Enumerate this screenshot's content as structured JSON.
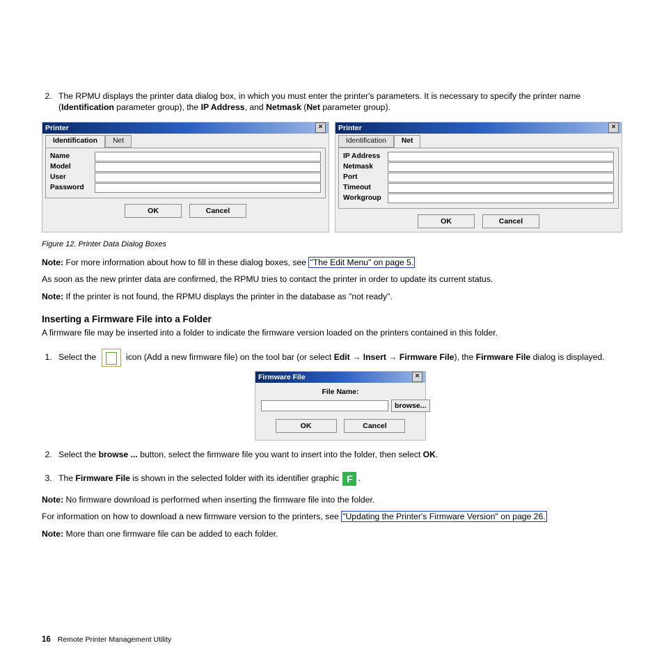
{
  "list2": {
    "pre": "The RPMU displays the printer data dialog box, in which you must enter the printer's parameters. It is necessary to specify the printer name (",
    "b1": "Identification",
    "mid1": " parameter group), the ",
    "b2": "IP Address",
    "mid2": ", and ",
    "b3": "Netmask",
    "mid3": " (",
    "b4": "Net",
    "post": " parameter group)."
  },
  "dlg1": {
    "title": "Printer",
    "tab1": "Identification",
    "tab2": "Net",
    "f1": "Name",
    "f2": "Model",
    "f3": "User",
    "f4": "Password",
    "ok": "OK",
    "cancel": "Cancel"
  },
  "dlg2": {
    "title": "Printer",
    "tab1": "Identification",
    "tab2": "Net",
    "f1": "IP Address",
    "f2": "Netmask",
    "f3": "Port",
    "f4": "Timeout",
    "f5": "Workgroup",
    "ok": "OK",
    "cancel": "Cancel"
  },
  "caption": "Figure 12. Printer Data Dialog Boxes",
  "note1": {
    "b": "Note:",
    "t": " For more information about how to fill in these dialog boxes, see ",
    "link": "\"The Edit Menu\" on page 5."
  },
  "p_after": "As soon as the new printer data are confirmed, the RPMU tries to contact the printer in order to update its current status.",
  "note2": {
    "b": "Note:",
    "t": " If the printer is not found, the RPMU displays the printer in the database as \"not ready\"."
  },
  "section_h": "Inserting a Firmware File into a Folder",
  "section_p": "A firmware file may be inserted into a folder to indicate the firmware version loaded on the printers contained in this folder.",
  "step1": {
    "pre": "Select the ",
    "mid": " icon (Add a new firmware file) on the tool bar (or select ",
    "b1": "Edit",
    "arrow": " → ",
    "b2": "Insert",
    "b3": "Firmware File",
    "close": "), the ",
    "b4": "Firmware File",
    "end": " dialog is displayed."
  },
  "fwdlg": {
    "title": "Firmware File",
    "label": "File Name:",
    "browse": "browse...",
    "ok": "OK",
    "cancel": "Cancel"
  },
  "step2": {
    "pre": "Select the ",
    "b1": "browse ...",
    "mid": " button, select the firmware file you want to insert into the folder, then select ",
    "b2": "OK",
    "end": "."
  },
  "step3": {
    "pre": "The ",
    "b1": "Firmware File",
    "mid": " is shown in the selected folder with its identifier graphic ",
    "icon": "F",
    "end": "."
  },
  "note3": {
    "b": "Note:",
    "t": " No firmware download is performed when inserting the firmware file into the folder."
  },
  "p_info": {
    "pre": "For information on how to download a new firmware version to the printers, see ",
    "link": "\"Updating the Printer's Firmware Version\" on page 26."
  },
  "note4": {
    "b": "Note:",
    "t": " More than one firmware file can be added to each folder."
  },
  "footer": {
    "num": "16",
    "title": "Remote Printer Management Utility"
  }
}
